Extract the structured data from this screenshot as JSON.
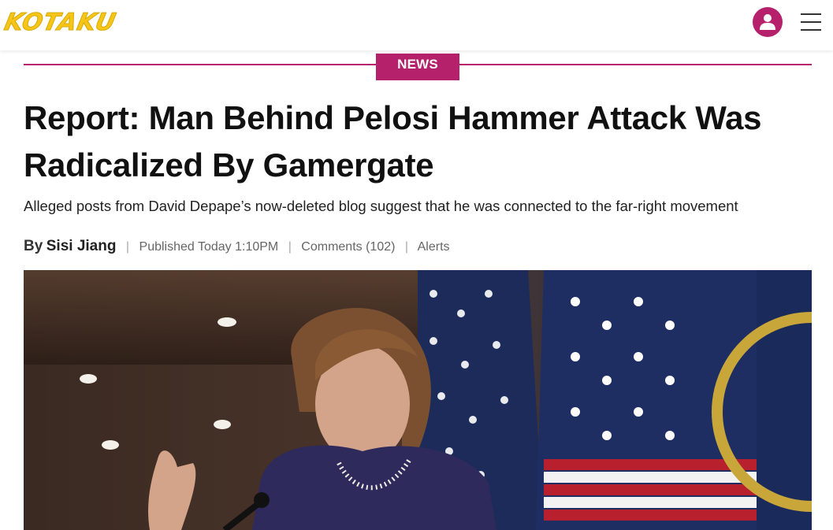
{
  "header": {
    "logo_text": "KOTAKU",
    "icons": {
      "account": "user-icon",
      "menu": "hamburger-icon"
    },
    "colors": {
      "logo": "#f5c518",
      "accent": "#b5226b"
    }
  },
  "article": {
    "category": "NEWS",
    "headline": "Report: Man Behind Pelosi Hammer Attack Was Radicalized By Gamergate",
    "subheadline": "Alleged posts from David Depape’s now-deleted blog suggest that he was connected to the far-right movement",
    "byline": {
      "by_label": "By",
      "author": "Sisi Jiang",
      "published_label": "Published",
      "published_time": "Today 1:10PM",
      "comments": "Comments (102)",
      "alerts": "Alerts"
    },
    "hero_image": {
      "subject": "speaker-at-podium-with-flags"
    }
  }
}
